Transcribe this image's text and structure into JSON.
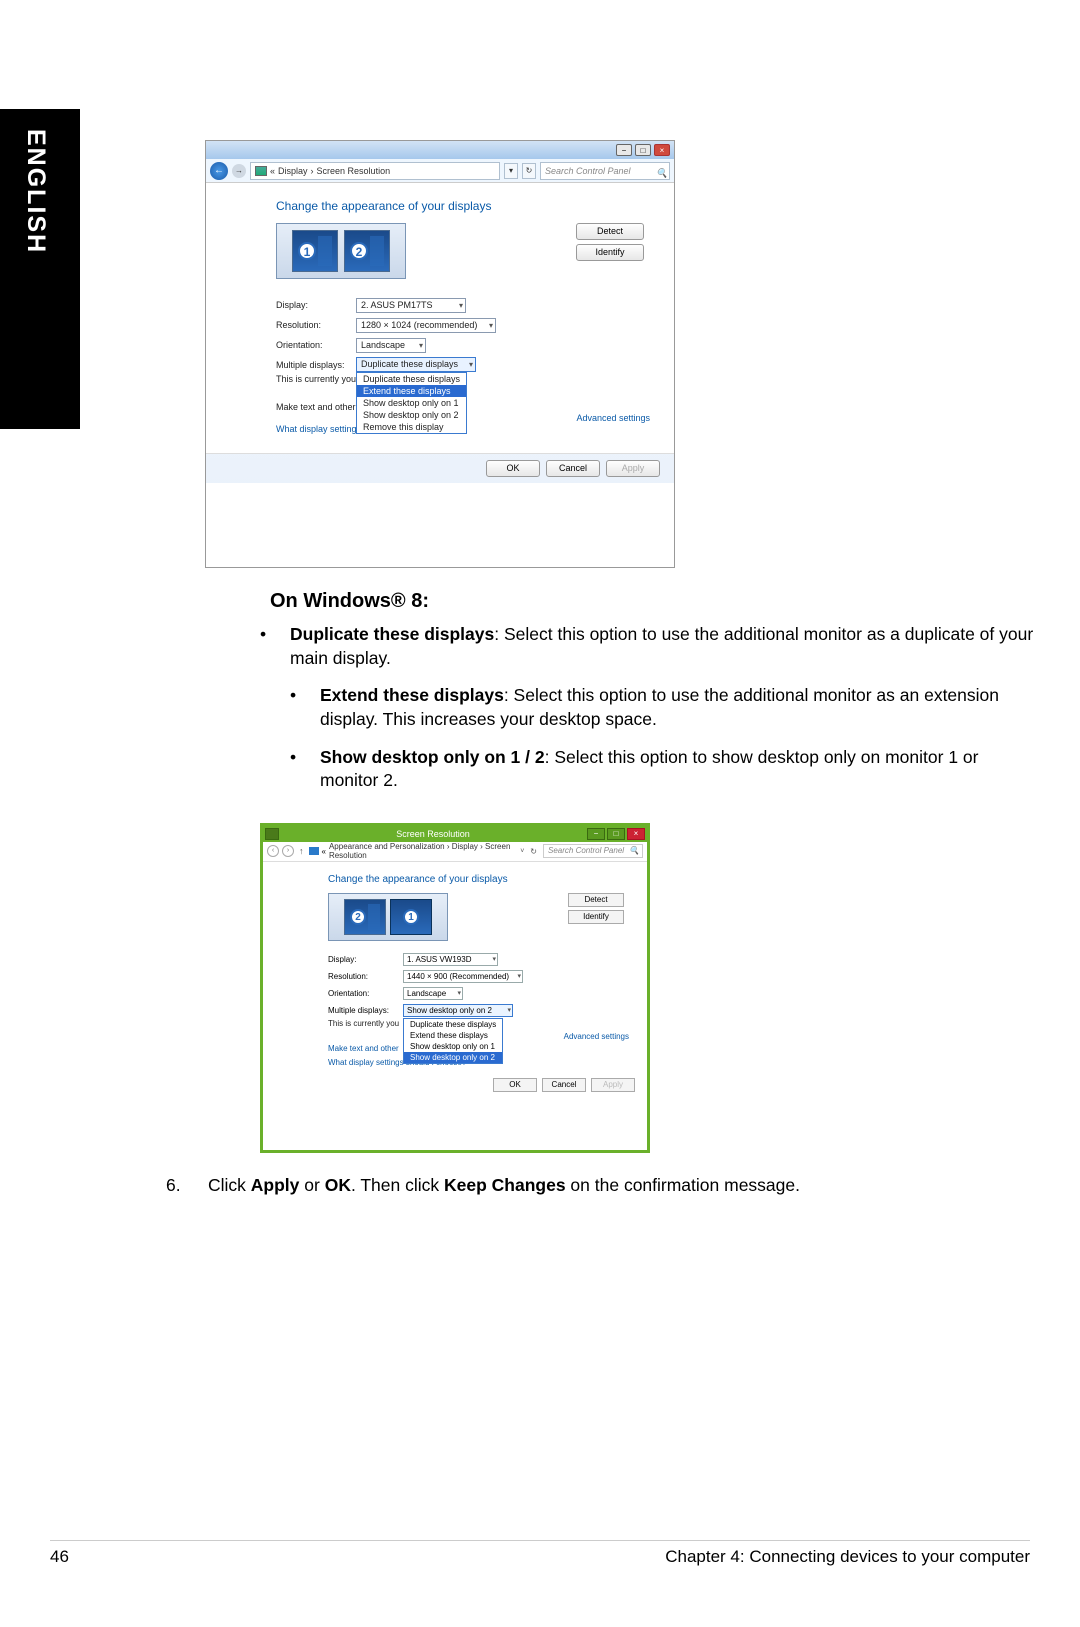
{
  "language": "ENGLISH",
  "win7": {
    "breadcrumb_parts": [
      "«",
      "Display",
      "›",
      "Screen Resolution"
    ],
    "search_placeholder": "Search Control Panel",
    "heading": "Change the appearance of your displays",
    "detect": "Detect",
    "identify": "Identify",
    "labels": {
      "display": "Display:",
      "resolution": "Resolution:",
      "orientation": "Orientation:",
      "multiple": "Multiple displays:"
    },
    "values": {
      "display": "2. ASUS PM17TS",
      "resolution": "1280 × 1024 (recommended)",
      "orientation": "Landscape",
      "multiple": "Duplicate these displays"
    },
    "dropdown": [
      "Duplicate these displays",
      "Extend these displays",
      "Show desktop only on 1",
      "Show desktop only on 2",
      "Remove this display"
    ],
    "main_disp_prefix": "This is currently you",
    "make_text_prefix": "Make text and other",
    "help_link": "What display settings should I choose?",
    "advanced": "Advanced settings",
    "ok": "OK",
    "cancel": "Cancel",
    "apply": "Apply"
  },
  "section_heading": "On Windows® 8:",
  "bullets": {
    "b1_bold": "Duplicate these displays",
    "b1_rest": ": Select this option to use the additional monitor as a duplicate of your main display.",
    "b2_bold": "Extend these displays",
    "b2_rest": ": Select this option to use the additional monitor as an extension display. This increases your desktop space.",
    "b3_bold": "Show desktop only on 1 / 2",
    "b3_rest": ": Select this option to show desktop only on monitor 1 or monitor 2."
  },
  "win8": {
    "title": "Screen Resolution",
    "breadcrumb": "Appearance and Personalization  ›  Display  ›  Screen Resolution",
    "search_placeholder": "Search Control Panel",
    "heading": "Change the appearance of your displays",
    "detect": "Detect",
    "identify": "Identify",
    "labels": {
      "display": "Display:",
      "resolution": "Resolution:",
      "orientation": "Orientation:",
      "multiple": "Multiple displays:"
    },
    "values": {
      "display": "1. ASUS VW193D",
      "resolution": "1440 × 900 (Recommended)",
      "orientation": "Landscape",
      "multiple": "Show desktop only on 2"
    },
    "dropdown": [
      "Duplicate these displays",
      "Extend these displays",
      "Show desktop only on 1",
      "Show desktop only on 2"
    ],
    "main_disp_prefix": "This is currently you",
    "make_text_prefix": "Make text and other",
    "help_link": "What display settings should I choose?",
    "advanced": "Advanced settings",
    "ok": "OK",
    "cancel": "Cancel",
    "apply": "Apply"
  },
  "step6": {
    "num": "6.",
    "pre": "Click ",
    "b1": "Apply",
    "mid1": " or ",
    "b2": "OK",
    "mid2": ". Then click ",
    "b3": "Keep Changes",
    "post": " on the confirmation message."
  },
  "footer": {
    "page": "46",
    "chapter": "Chapter 4: Connecting devices to your computer"
  }
}
